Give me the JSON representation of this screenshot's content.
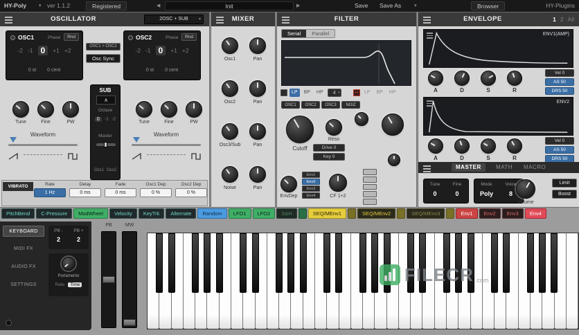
{
  "titlebar": {
    "app": "HY-Poly",
    "version": "ver 1.1.2",
    "registered": "Registered",
    "preset": "Init",
    "save": "Save",
    "save_as": "Save As",
    "browser": "Browser",
    "brand": "HY-Plugins"
  },
  "oscillator": {
    "title": "OSCILLATOR",
    "mode": "2OSC + SUB",
    "osc1_name": "OSC1",
    "osc2_name": "OSC2",
    "phase_label": "Phase",
    "rnd_label": "Rnd",
    "octave_steps": [
      "-2",
      "-1",
      "0",
      "+1",
      "+2"
    ],
    "selected_step": "0",
    "semi": "0 st",
    "cent": "0 cent",
    "link_label": "OSC1 > OSC2",
    "sync_label": "Osc Sync",
    "knob_labels": [
      "Tune",
      "Fine",
      "PW"
    ],
    "waveform_label": "Waveform",
    "sub": {
      "title": "SUB",
      "octave_label": "Octave",
      "octave_values": [
        "0",
        "-1",
        "-2"
      ],
      "master_label": "Master",
      "routing_labels": [
        "Osc1",
        "Osc2"
      ]
    },
    "vibrato": {
      "title": "VIBRATO",
      "fields": [
        {
          "label": "Rate",
          "value": "1 Hz"
        },
        {
          "label": "Delay",
          "value": "0 ms"
        },
        {
          "label": "Fade",
          "value": "0 ms"
        },
        {
          "label": "Osc1 Dep",
          "value": "0 %"
        },
        {
          "label": "Osc2 Dep",
          "value": "0 %"
        }
      ]
    }
  },
  "mixer": {
    "title": "MIXER",
    "rows": [
      {
        "level": "Osc1",
        "pan": "Pan"
      },
      {
        "level": "Osc2",
        "pan": "Pan"
      },
      {
        "level": "Osc3/Sub",
        "pan": "Pan"
      },
      {
        "level": "Noise",
        "pan": "Pan"
      }
    ]
  },
  "filter": {
    "title": "FILTER",
    "routing": [
      "Serial",
      "Parallel"
    ],
    "selected_routing": "Serial",
    "types": [
      "LP",
      "BP",
      "HP"
    ],
    "selected_type": "LP",
    "slope": "4",
    "sources": [
      "OSC1",
      "OSC2",
      "OSC3",
      "NOIZ"
    ],
    "cutoff_label": "Cutoff",
    "reso_label": "Reso",
    "drive": "Drive 0",
    "key": "Key 0",
    "envdep_label": "EnvDep",
    "env_buttons": [
      "Env1",
      "Env2",
      "Env3",
      "Env4"
    ],
    "cf_label": "CF 1+2"
  },
  "envelope": {
    "title": "ENVELOPE",
    "tabs": [
      "1",
      "2",
      "All"
    ],
    "knob_labels": [
      "A",
      "D",
      "S",
      "R"
    ],
    "env1": {
      "name": "ENV1(AMP)",
      "vel": "Vel 0",
      "as50": "AS 50",
      "drs50": "DRS 50"
    },
    "env2": {
      "name": "ENV2",
      "vel": "Vel 0",
      "as50": "AS 50",
      "drs50": "DRS 50"
    }
  },
  "master": {
    "tabs": [
      "MASTER",
      "MATH",
      "MACRO"
    ],
    "tune_label": "Tune",
    "fine_label": "Fine",
    "tune_value": "0",
    "fine_value": "0",
    "mode_label": "Mode",
    "voice_label": "Voice",
    "mode_value": "Poly",
    "voice_value": "8",
    "volume_label": "Volume",
    "limit_label": "Limit",
    "boost_label": "Boost"
  },
  "mod_sources": [
    {
      "label": "PitchBend",
      "style": "teal"
    },
    {
      "label": "C-Pressure",
      "style": "teal"
    },
    {
      "label": "ModWheel",
      "style": "green-fill"
    },
    {
      "label": "Velocity",
      "style": "teal"
    },
    {
      "label": "KeyTrk",
      "style": "teal"
    },
    {
      "label": "Alternate",
      "style": "teal"
    },
    {
      "label": "Random",
      "style": "blue-fill"
    },
    {
      "label": "LFO1",
      "style": "green-fill"
    },
    {
      "label": "LFO2",
      "style": "green-fill"
    },
    {
      "label": "S&H",
      "style": "green-dim"
    },
    {
      "icon": "seq-grid-icon",
      "style": "icon-green"
    },
    {
      "label": "SEQ/MEnv1",
      "style": "yellow-fill"
    },
    {
      "icon": "menv1-icon",
      "style": "icon-yellow"
    },
    {
      "label": "SEQ/MEnv2",
      "style": "yellow-text"
    },
    {
      "icon": "menv2-icon",
      "style": "icon-yellow"
    },
    {
      "label": "SEQ/MEnv3",
      "style": "yellow-dim"
    },
    {
      "icon": "menv3-icon",
      "style": "icon-yellow"
    },
    {
      "label": "Env1",
      "style": "red-fill"
    },
    {
      "label": "Env2",
      "style": "red-text"
    },
    {
      "label": "Env3",
      "style": "red-text"
    },
    {
      "label": "Env4",
      "style": "pink-fill"
    }
  ],
  "bottom": {
    "menu": [
      "KEYBOARD",
      "MIDI FX",
      "AUDIO FX",
      "SETTINGS"
    ],
    "selected_menu": "KEYBOARD",
    "pb_minus_label": "PB -",
    "pb_plus_label": "PB +",
    "pb_minus_value": "2",
    "pb_plus_value": "2",
    "portamento_label": "Portamento",
    "rate_label": "Rate",
    "time_label": "Time",
    "pb_label": "PB",
    "mw_label": "MW"
  },
  "keyboard": {
    "white_keys": 36
  },
  "watermark": {
    "text": "FILECR",
    "suffix": ".com"
  }
}
